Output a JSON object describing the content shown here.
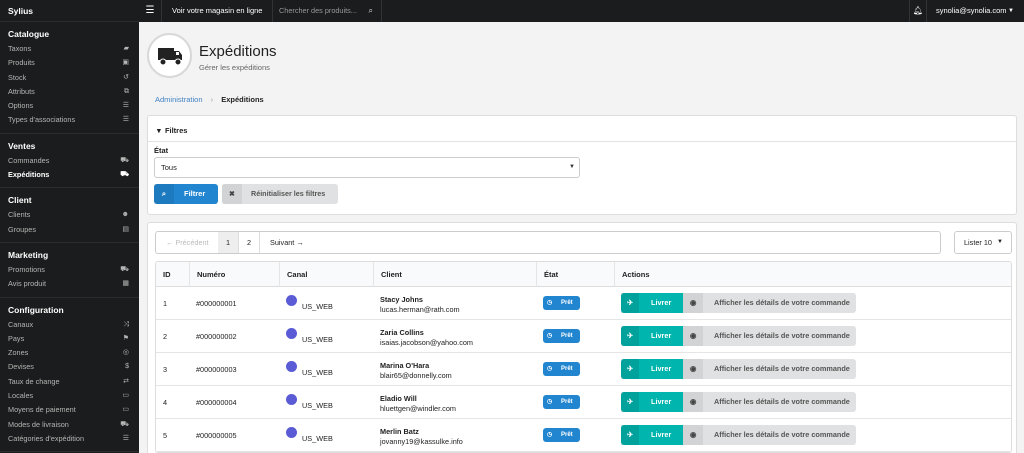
{
  "brand": "Sylius",
  "sidebar": {
    "sections": [
      {
        "title": "Catalogue",
        "items": [
          {
            "label": "Taxons",
            "icon": "folder-icon",
            "glyph": "▰"
          },
          {
            "label": "Produits",
            "icon": "cube-icon",
            "glyph": "▣"
          },
          {
            "label": "Stock",
            "icon": "history-icon",
            "glyph": "↺"
          },
          {
            "label": "Attributs",
            "icon": "cubes-icon",
            "glyph": "⧉"
          },
          {
            "label": "Options",
            "icon": "options-icon",
            "glyph": "☰"
          },
          {
            "label": "Types d'associations",
            "icon": "tasks-icon",
            "glyph": "☰"
          }
        ]
      },
      {
        "title": "Ventes",
        "items": [
          {
            "label": "Commandes",
            "icon": "cart-icon",
            "glyph": "⛟"
          },
          {
            "label": "Expéditions",
            "icon": "truck-icon",
            "glyph": "⛟",
            "active": true
          }
        ]
      },
      {
        "title": "Client",
        "items": [
          {
            "label": "Clients",
            "icon": "users-icon",
            "glyph": "☻"
          },
          {
            "label": "Groupes",
            "icon": "archive-icon",
            "glyph": "▤"
          }
        ]
      },
      {
        "title": "Marketing",
        "items": [
          {
            "label": "Promotions",
            "icon": "cart-promo-icon",
            "glyph": "⛟"
          },
          {
            "label": "Avis produit",
            "icon": "newspaper-icon",
            "glyph": "▦"
          }
        ]
      },
      {
        "title": "Configuration",
        "items": [
          {
            "label": "Canaux",
            "icon": "random-icon",
            "glyph": "⤨"
          },
          {
            "label": "Pays",
            "icon": "flag-icon",
            "glyph": "⚑"
          },
          {
            "label": "Zones",
            "icon": "globe-icon",
            "glyph": "◎"
          },
          {
            "label": "Devises",
            "icon": "dollar-icon",
            "glyph": "$"
          },
          {
            "label": "Taux de change",
            "icon": "exchange-icon",
            "glyph": "⇄"
          },
          {
            "label": "Locales",
            "icon": "translate-icon",
            "glyph": "▭"
          },
          {
            "label": "Moyens de paiement",
            "icon": "payment-icon",
            "glyph": "▭"
          },
          {
            "label": "Modes de livraison",
            "icon": "shipping-icon",
            "glyph": "⛟"
          },
          {
            "label": "Catégories d'expédition",
            "icon": "list-icon",
            "glyph": "☰"
          }
        ]
      }
    ]
  },
  "topbar": {
    "store_link": "Voir votre magasin en ligne",
    "search_placeholder": "Chercher des produits...",
    "user": "synolia@synolia.com"
  },
  "header": {
    "title": "Expéditions",
    "subtitle": "Gérer les expéditions",
    "icon": "truck-icon"
  },
  "breadcrumb": {
    "root": "Administration",
    "current": "Expéditions"
  },
  "filters": {
    "toggle_label": "Filtres",
    "state_label": "État",
    "state_value": "Tous",
    "filter_button": "Filtrer",
    "reset_button": "Réinitialiser les filtres"
  },
  "pagination": {
    "previous": "← Précédent",
    "pages": [
      "1",
      "2"
    ],
    "current_page": "1",
    "next": "Suivant →",
    "per_page": "Lister 10"
  },
  "table": {
    "columns": [
      "ID",
      "Numéro",
      "Canal",
      "Client",
      "État",
      "Actions"
    ],
    "rows": [
      {
        "id": "1",
        "number": "#000000001",
        "channel": "US_WEB",
        "customer_name": "Stacy Johns",
        "customer_email": "lucas.herman@rath.com",
        "state": "Prêt"
      },
      {
        "id": "2",
        "number": "#000000002",
        "channel": "US_WEB",
        "customer_name": "Zaria Collins",
        "customer_email": "isaias.jacobson@yahoo.com",
        "state": "Prêt"
      },
      {
        "id": "3",
        "number": "#000000003",
        "channel": "US_WEB",
        "customer_name": "Marina O'Hara",
        "customer_email": "blair65@donnelly.com",
        "state": "Prêt"
      },
      {
        "id": "4",
        "number": "#000000004",
        "channel": "US_WEB",
        "customer_name": "Eladio Will",
        "customer_email": "hluettgen@windler.com",
        "state": "Prêt"
      },
      {
        "id": "5",
        "number": "#000000005",
        "channel": "US_WEB",
        "customer_name": "Merlin Batz",
        "customer_email": "jovanny19@kassulke.info",
        "state": "Prêt"
      }
    ],
    "ship_button": "Livrer",
    "details_button": "Afficher les détails de votre commande"
  },
  "colors": {
    "primary": "#2185d0",
    "teal": "#00b5ad",
    "channel": "#5b5bd6",
    "sidebar_bg": "#1b1c1d"
  }
}
